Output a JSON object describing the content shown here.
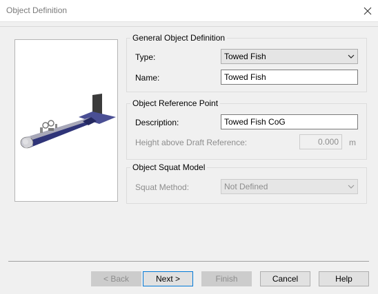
{
  "window": {
    "title": "Object Definition"
  },
  "general": {
    "group_title": "General Object Definition",
    "type_label": "Type:",
    "type_value": "Towed Fish",
    "name_label": "Name:",
    "name_value": "Towed Fish"
  },
  "reference": {
    "group_title": "Object Reference Point",
    "description_label": "Description:",
    "description_value": "Towed Fish CoG",
    "height_label": "Height above Draft Reference:",
    "height_value": "0.000",
    "height_unit": "m"
  },
  "squat": {
    "group_title": "Object Squat Model",
    "method_label": "Squat Method:",
    "method_value": "Not Defined"
  },
  "buttons": {
    "back": "< Back",
    "next": "Next >",
    "finish": "Finish",
    "cancel": "Cancel",
    "help": "Help"
  },
  "icons": {
    "close": "close-icon",
    "dropdown": "chevron-down-icon"
  },
  "colors": {
    "default_button_border": "#0078d7",
    "disabled_text": "#8d8d8d",
    "preview_body": "#3a3f85"
  }
}
